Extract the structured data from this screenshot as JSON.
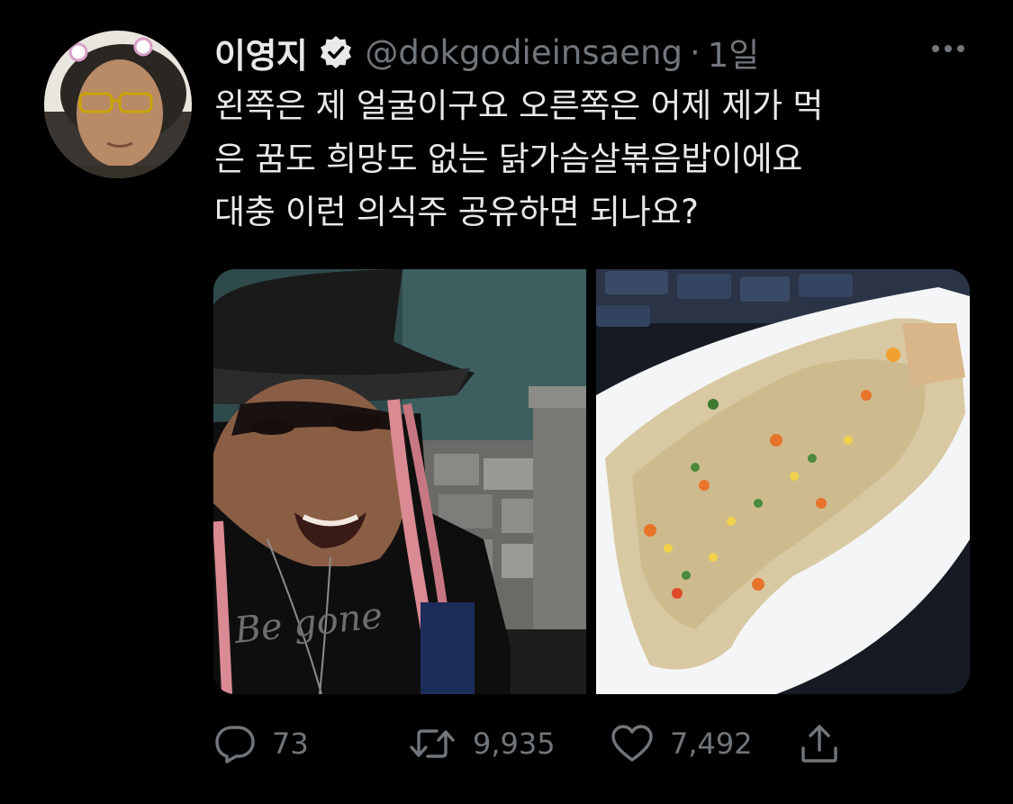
{
  "author": {
    "display_name": "이영지",
    "handle": "@dokgodieinsaeng",
    "separator": "·",
    "timestamp": "1일",
    "verified": true,
    "avatar_icon": "profile-photo"
  },
  "tweet": {
    "lines": [
      "왼쪽은 제 얼굴이구요 오른쪽은 어제 제가 먹",
      "은 꿈도 희망도 없는 닭가슴살볶음밥이에요",
      "대충 이런 의식주 공유하면 되나요?"
    ]
  },
  "media": {
    "left_photo": "selfie-photo",
    "left_photo_shirt_text": "Be gone",
    "right_photo": "fried-rice-photo"
  },
  "actions": {
    "replies": "73",
    "retweets": "9,935",
    "likes": "7,492",
    "share_icon": "share-icon"
  },
  "colors": {
    "background": "#000000",
    "primary_text": "#e7e9ea",
    "secondary_text": "#71767b",
    "verified_badge": "#e7e9ea"
  }
}
